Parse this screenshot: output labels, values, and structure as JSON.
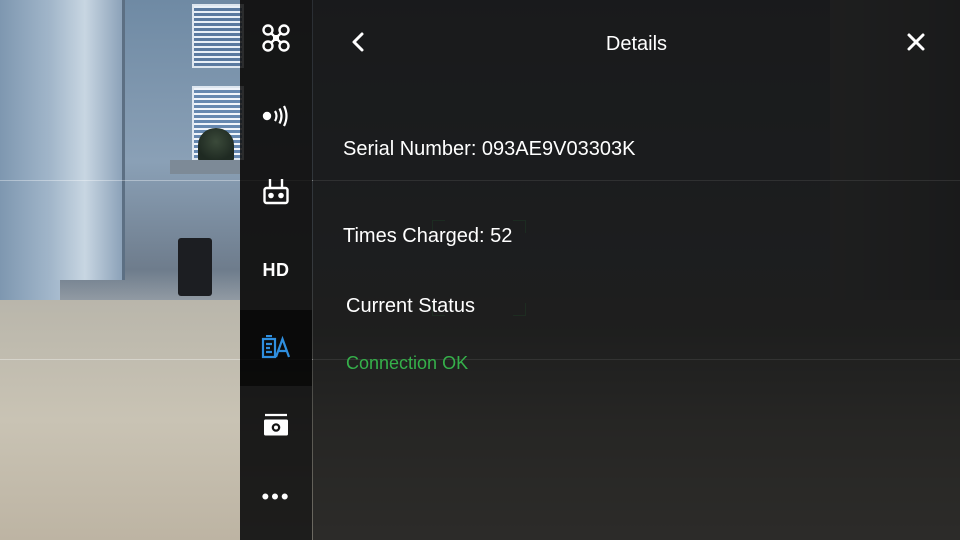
{
  "sidebar": {
    "items": [
      {
        "icon": "aircraft-icon",
        "label": ""
      },
      {
        "icon": "signal-icon",
        "label": ""
      },
      {
        "icon": "remote-controller-icon",
        "label": ""
      },
      {
        "icon": "hd-icon",
        "label": "HD"
      },
      {
        "icon": "battery-icon",
        "label": "",
        "active": true
      },
      {
        "icon": "camera-settings-icon",
        "label": ""
      },
      {
        "icon": "more-icon",
        "label": "•••"
      }
    ]
  },
  "details": {
    "title": "Details",
    "serial_number": "Serial Number: 093AE9V03303K",
    "times_charged": "Times Charged: 52",
    "status_heading": "Current Status",
    "status_value": "Connection OK"
  },
  "colors": {
    "accent_blue": "#2f8fe0",
    "status_ok": "#35b04a",
    "text": "#ffffff"
  }
}
